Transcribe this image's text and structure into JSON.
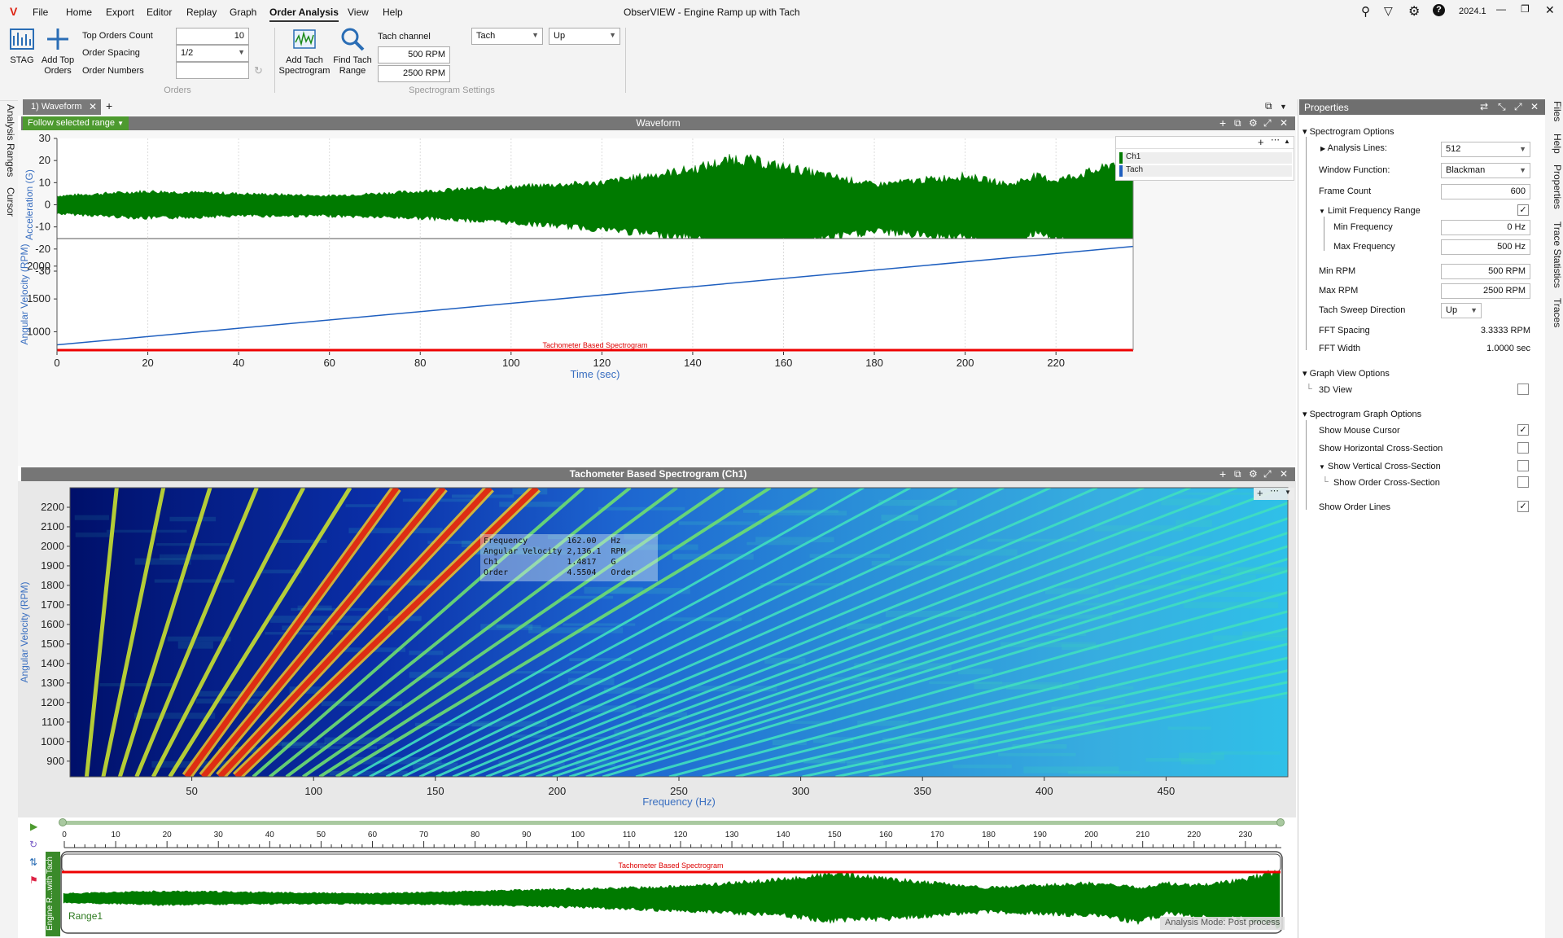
{
  "menu": {
    "logo": "V",
    "items": [
      "File",
      "Home",
      "Export",
      "Editor",
      "Replay",
      "Graph",
      "Order Analysis",
      "View",
      "Help"
    ],
    "active": "Order Analysis",
    "title": "ObserVIEW - Engine Ramp up with Tach",
    "version": "2024.1"
  },
  "ribbon": {
    "stag_label": "STAG",
    "add_top_orders_label": "Add Top Orders",
    "top_orders_count_label": "Top Orders Count",
    "top_orders_count_value": "10",
    "order_spacing_label": "Order Spacing",
    "order_spacing_value": "1/2",
    "order_numbers_label": "Order Numbers",
    "order_numbers_value": "",
    "orders_group": "Orders",
    "add_tach_spectrogram_label": "Add Tach Spectrogram",
    "find_tach_range_label": "Find Tach Range",
    "tach_channel_label": "Tach channel",
    "tach_channel_value": "Tach",
    "direction_value": "Up",
    "min_rpm": "500 RPM",
    "max_rpm": "2500 RPM",
    "spectrogram_group": "Spectrogram Settings"
  },
  "left_tabs": [
    "Analysis Ranges",
    "Cursor"
  ],
  "right_tabs": [
    "Files",
    "Help",
    "Properties",
    "Trace Statistics",
    "Traces"
  ],
  "doc_tab": "1) Waveform",
  "waveform": {
    "header": "Waveform",
    "follow_label": "Follow selected range",
    "legend": [
      "Ch1",
      "Tach"
    ],
    "tach_label": "Tachometer Based Spectrogram"
  },
  "spectro": {
    "header": "Tachometer Based Spectrogram (Ch1)",
    "tooltip": [
      [
        "Frequency",
        "162.00",
        "Hz"
      ],
      [
        "Angular Velocity",
        "2,136.1",
        "RPM"
      ],
      [
        "Ch1",
        "1.4817",
        "G"
      ],
      [
        "Order",
        "4.5504",
        "Order"
      ]
    ]
  },
  "timeline": {
    "ticks": [
      "0",
      "10",
      "20",
      "30",
      "40",
      "50",
      "60",
      "70",
      "80",
      "90",
      "100",
      "110",
      "120",
      "130",
      "140",
      "150",
      "160",
      "170",
      "180",
      "190",
      "200",
      "210",
      "220",
      "230"
    ],
    "overview_label": "Tachometer Based Spectrogram",
    "range_label": "Range1",
    "side_label": "Engine R...with Tach",
    "status": "Analysis Mode: Post process"
  },
  "properties": {
    "title": "Properties",
    "spectrogram_options": "Spectrogram Options",
    "analysis_lines": "Analysis Lines:",
    "analysis_lines_value": "512",
    "window_function": "Window Function:",
    "window_function_value": "Blackman",
    "frame_count": "Frame Count",
    "frame_count_value": "600",
    "limit_freq": "Limit Frequency Range",
    "min_freq": "Min Frequency",
    "min_freq_value": "0 Hz",
    "max_freq": "Max Frequency",
    "max_freq_value": "500 Hz",
    "min_rpm": "Min RPM",
    "min_rpm_value": "500 RPM",
    "max_rpm": "Max RPM",
    "max_rpm_value": "2500 RPM",
    "tach_sweep": "Tach Sweep Direction",
    "tach_sweep_value": "Up",
    "fft_spacing": "FFT Spacing",
    "fft_spacing_value": "3.3333 RPM",
    "fft_width": "FFT Width",
    "fft_width_value": "1.0000 sec",
    "graph_view_options": "Graph View Options",
    "view_3d": "3D View",
    "spectro_graph_options": "Spectrogram Graph Options",
    "show_mouse_cursor": "Show Mouse Cursor",
    "show_hcs": "Show Horizontal Cross-Section",
    "show_vcs": "Show Vertical Cross-Section",
    "show_ocs": "Show Order Cross-Section",
    "show_order_lines": "Show Order Lines",
    "check_mark": "✓"
  },
  "chart_data": [
    {
      "type": "line",
      "title": "Waveform",
      "xlabel": "Time (sec)",
      "ylabel": "Acceleration (G)",
      "x_ticks": [
        0,
        20,
        40,
        60,
        80,
        100,
        120,
        140,
        160,
        180,
        200,
        220
      ],
      "y_ticks": [
        -30,
        -20,
        -10,
        0,
        10,
        20,
        30
      ],
      "xlim": [
        0,
        237
      ],
      "ylim": [
        -30,
        30
      ],
      "series": [
        {
          "name": "Ch1",
          "color": "#007a00",
          "envelope_x": [
            0,
            20,
            40,
            60,
            80,
            100,
            120,
            140,
            150,
            160,
            180,
            200,
            210,
            215,
            220,
            230,
            237
          ],
          "envelope_upper": [
            4,
            6,
            5,
            4,
            6,
            8,
            10,
            16,
            21,
            17,
            9,
            13,
            9,
            13,
            11,
            16,
            24
          ],
          "envelope_lower": [
            -4,
            -6,
            -5,
            -5,
            -6,
            -8,
            -11,
            -15,
            -20,
            -18,
            -12,
            -15,
            -21,
            -13,
            -16,
            -18,
            -24
          ]
        }
      ]
    },
    {
      "type": "line",
      "xlabel": "Time (sec)",
      "ylabel": "Angular Velocity (RPM)",
      "x_ticks": [
        0,
        20,
        40,
        60,
        80,
        100,
        120,
        140,
        160,
        180,
        200,
        220
      ],
      "y_ticks": [
        1000,
        1500,
        2000
      ],
      "xlim": [
        0,
        237
      ],
      "ylim": [
        720,
        2420
      ],
      "series": [
        {
          "name": "Tach",
          "color": "#1f5fbf",
          "x": [
            0,
            237
          ],
          "y": [
            800,
            2300
          ]
        }
      ]
    },
    {
      "type": "heatmap",
      "title": "Tachometer Based Spectrogram (Ch1)",
      "xlabel": "Frequency (Hz)",
      "ylabel": "Angular Velocity (RPM)",
      "x_ticks": [
        50,
        100,
        150,
        200,
        250,
        300,
        350,
        400,
        450
      ],
      "y_ticks": [
        900,
        1000,
        1100,
        1200,
        1300,
        1400,
        1500,
        1600,
        1700,
        1800,
        1900,
        2000,
        2100,
        2200
      ],
      "xlim": [
        0,
        500
      ],
      "ylim": [
        820,
        2300
      ],
      "order_lines": [
        0.5,
        1,
        1.5,
        2,
        2.5,
        3,
        3.5,
        4,
        4.5,
        5,
        5.5,
        6,
        6.5,
        7,
        7.5,
        8,
        8.5,
        9,
        9.5,
        10,
        10.5,
        11,
        11.5,
        12,
        12.5,
        13,
        13.5,
        14,
        14.5,
        15,
        15.5,
        16,
        17,
        18,
        19,
        20,
        21,
        22,
        23,
        24
      ],
      "strong_orders": [
        4.5,
        4,
        5,
        3.5
      ]
    }
  ]
}
